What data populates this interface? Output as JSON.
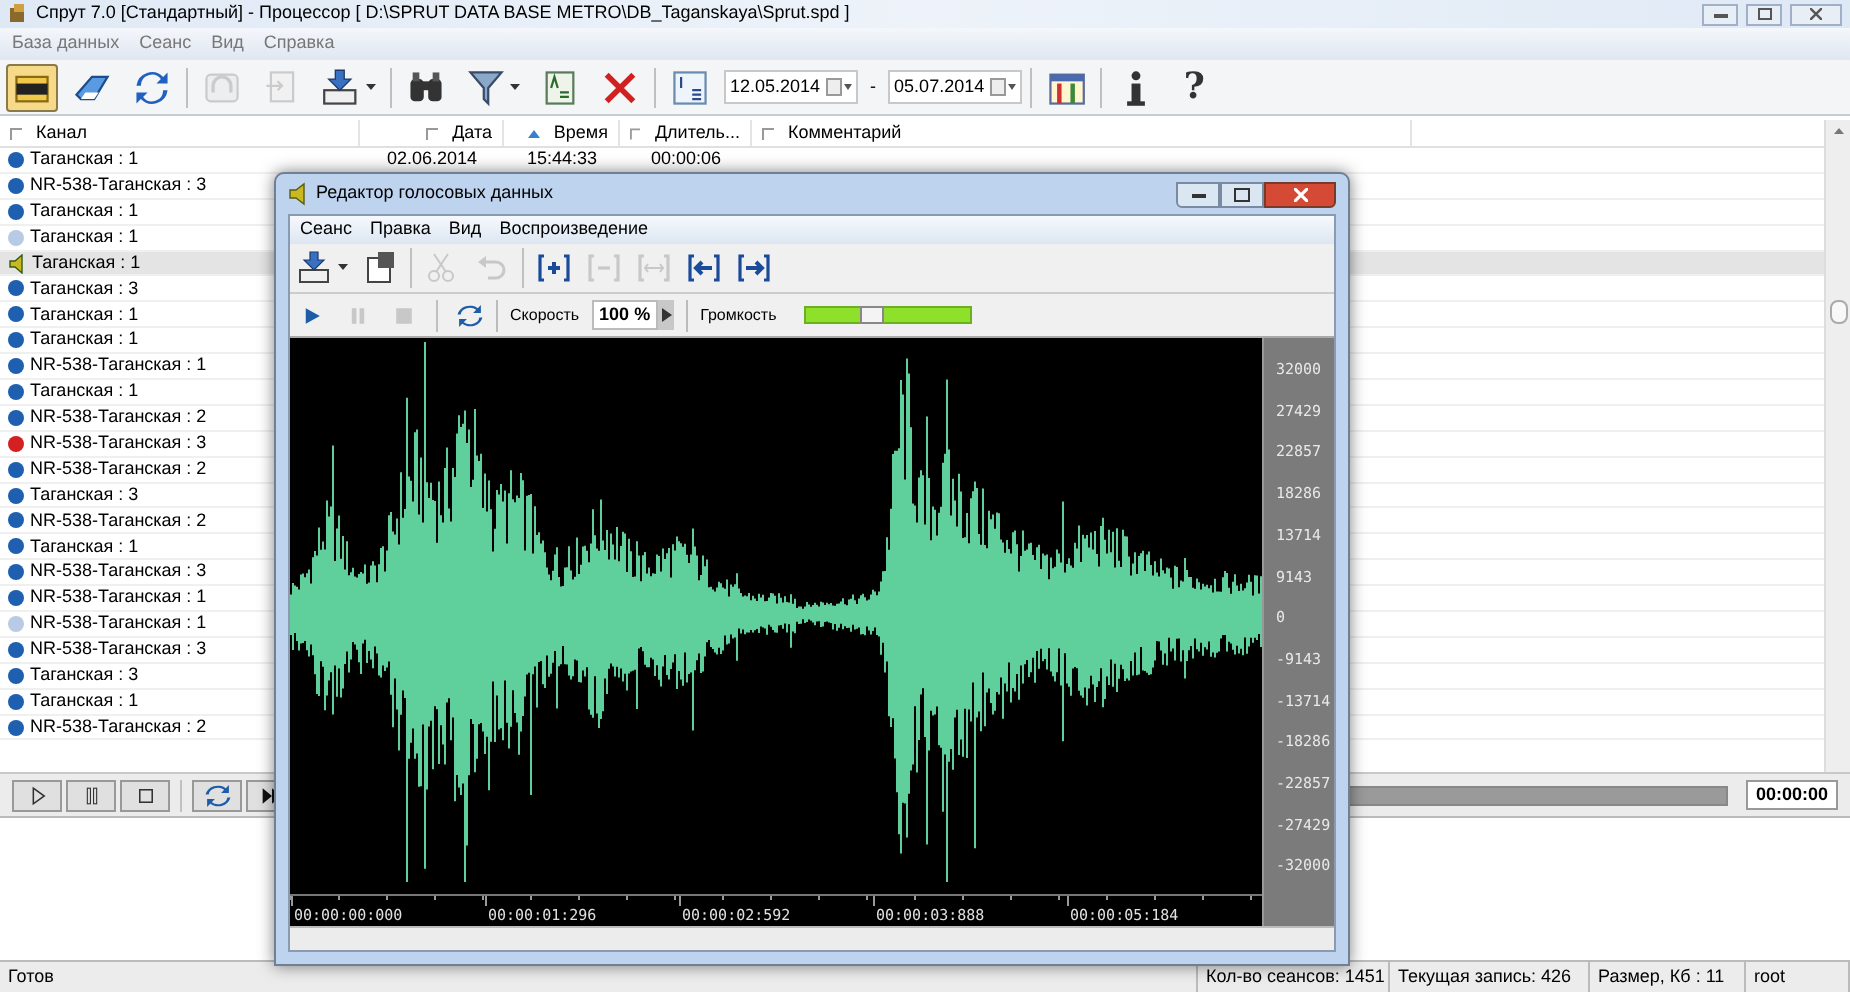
{
  "window": {
    "title": "Спрут 7.0 [Стандартный] - Процессор [ D:\\SPRUT DATA BASE METRO\\DB_Taganskaya\\Sprut.spd ]"
  },
  "menu": [
    "База данных",
    "Сеанс",
    "Вид",
    "Справка"
  ],
  "toolbar": [
    {
      "kind": "open-db",
      "pressed": true,
      "disabled": false
    },
    {
      "kind": "eraser",
      "pressed": false,
      "disabled": false
    },
    {
      "kind": "refresh",
      "pressed": false,
      "disabled": false
    },
    {
      "kind": "separator"
    },
    {
      "kind": "headphones",
      "pressed": false,
      "disabled": true
    },
    {
      "kind": "export",
      "pressed": false,
      "disabled": true
    },
    {
      "kind": "download",
      "pressed": false,
      "disabled": false,
      "dropdown": true
    },
    {
      "kind": "separator"
    },
    {
      "kind": "binoculars",
      "pressed": false,
      "disabled": false
    },
    {
      "kind": "filter",
      "pressed": false,
      "disabled": false,
      "dropdown": true
    },
    {
      "kind": "dictionary",
      "pressed": false,
      "disabled": false
    },
    {
      "kind": "delete",
      "pressed": false,
      "disabled": false
    },
    {
      "kind": "separator"
    },
    {
      "kind": "sort",
      "pressed": false,
      "disabled": false
    },
    {
      "kind": "date-range"
    },
    {
      "kind": "separator"
    },
    {
      "kind": "columns",
      "pressed": false,
      "disabled": false
    },
    {
      "kind": "separator"
    },
    {
      "kind": "info",
      "pressed": false,
      "disabled": false
    },
    {
      "kind": "help",
      "glyph": "?",
      "pressed": false,
      "disabled": false
    }
  ],
  "date_range": {
    "from": "12.05.2014",
    "dash": "-",
    "to": "05.07.2014"
  },
  "table": {
    "columns": [
      {
        "label": "Канал",
        "sorted": false
      },
      {
        "label": "Дата",
        "sorted": false
      },
      {
        "label": "Время",
        "sorted": true
      },
      {
        "label": "Длитель...",
        "sorted": false
      },
      {
        "label": "Комментарий",
        "sorted": false
      }
    ],
    "rows": [
      {
        "kind": "dot",
        "color": "#1f5fb0",
        "channel": "Таганская : 1",
        "date": "02.06.2014",
        "time": "15:44:33",
        "duration": "00:00:06",
        "selected": false
      },
      {
        "kind": "dot",
        "color": "#1f5fb0",
        "channel": "NR-538-Таганская : 3",
        "selected": false
      },
      {
        "kind": "dot",
        "color": "#1f5fb0",
        "channel": "Таганская : 1",
        "selected": false
      },
      {
        "kind": "dot",
        "color": "#b8cbe6",
        "channel": "Таганская : 1",
        "selected": false
      },
      {
        "kind": "playing",
        "channel": "Таганская : 1",
        "selected": true
      },
      {
        "kind": "dot",
        "color": "#1f5fb0",
        "channel": "Таганская : 3",
        "selected": false
      },
      {
        "kind": "dot",
        "color": "#1f5fb0",
        "channel": "Таганская : 1",
        "selected": false
      },
      {
        "kind": "dot",
        "color": "#1f5fb0",
        "channel": "Таганская : 1",
        "selected": false
      },
      {
        "kind": "dot",
        "color": "#1f5fb0",
        "channel": "NR-538-Таганская : 1",
        "selected": false
      },
      {
        "kind": "dot",
        "color": "#1f5fb0",
        "channel": "Таганская : 1",
        "selected": false
      },
      {
        "kind": "dot",
        "color": "#1f5fb0",
        "channel": "NR-538-Таганская : 2",
        "selected": false
      },
      {
        "kind": "dot",
        "color": "#d42020",
        "channel": "NR-538-Таганская : 3",
        "selected": false
      },
      {
        "kind": "dot",
        "color": "#1f5fb0",
        "channel": "NR-538-Таганская : 2",
        "selected": false
      },
      {
        "kind": "dot",
        "color": "#1f5fb0",
        "channel": "Таганская : 3",
        "selected": false
      },
      {
        "kind": "dot",
        "color": "#1f5fb0",
        "channel": "NR-538-Таганская : 2",
        "selected": false
      },
      {
        "kind": "dot",
        "color": "#1f5fb0",
        "channel": "Таганская : 1",
        "selected": false
      },
      {
        "kind": "dot",
        "color": "#1f5fb0",
        "channel": "NR-538-Таганская : 3",
        "selected": false
      },
      {
        "kind": "dot",
        "color": "#1f5fb0",
        "channel": "NR-538-Таганская : 1",
        "selected": false
      },
      {
        "kind": "dot",
        "color": "#b8cbe6",
        "channel": "NR-538-Таганская : 1",
        "selected": false
      },
      {
        "kind": "dot",
        "color": "#1f5fb0",
        "channel": "NR-538-Таганская : 3",
        "selected": false
      },
      {
        "kind": "dot",
        "color": "#1f5fb0",
        "channel": "Таганская : 3",
        "selected": false
      },
      {
        "kind": "dot",
        "color": "#1f5fb0",
        "channel": "Таганская : 1",
        "selected": false
      },
      {
        "kind": "dot",
        "color": "#1f5fb0",
        "channel": "NR-538-Таганская : 2",
        "selected": false
      }
    ]
  },
  "player": {
    "time": "00:00:00",
    "level": 0
  },
  "status_bar": [
    "Готов",
    "Кол-во сеансов: 1451",
    "Текущая запись: 426",
    "Размер, Кб : 11",
    "root"
  ],
  "editor": {
    "title": "Редактор голосовых данных",
    "menu": [
      "Сеанс",
      "Правка",
      "Вид",
      "Воспроизведение"
    ],
    "toolbar": [
      {
        "kind": "download",
        "disabled": false,
        "dropdown": true
      },
      {
        "kind": "properties",
        "disabled": false
      },
      {
        "kind": "separator"
      },
      {
        "kind": "cut",
        "disabled": true
      },
      {
        "kind": "undo",
        "disabled": true
      },
      {
        "kind": "separator"
      },
      {
        "kind": "mark-add",
        "disabled": false
      },
      {
        "kind": "mark-remove",
        "disabled": true
      },
      {
        "kind": "mark-range",
        "disabled": true
      },
      {
        "kind": "mark-left",
        "disabled": false
      },
      {
        "kind": "mark-right",
        "disabled": false
      }
    ],
    "transport": [
      {
        "kind": "play",
        "disabled": false
      },
      {
        "kind": "pause",
        "disabled": true
      },
      {
        "kind": "stop",
        "disabled": true
      },
      {
        "kind": "separator"
      },
      {
        "kind": "loop",
        "disabled": false
      }
    ],
    "speed": {
      "label": "Скорость",
      "value": "100 %"
    },
    "volume": {
      "label": "Громкость",
      "level": 0.37
    },
    "y_axis": [
      "32000",
      "27429",
      "22857",
      "18286",
      "13714",
      "9143",
      "0",
      "-9143",
      "-13714",
      "-18286",
      "-22857",
      "-27429",
      "-32000"
    ],
    "time_axis": [
      "00:00:00:000",
      "00:00:01:296",
      "00:00:02:592",
      "00:00:03:888",
      "00:00:05:184"
    ]
  }
}
